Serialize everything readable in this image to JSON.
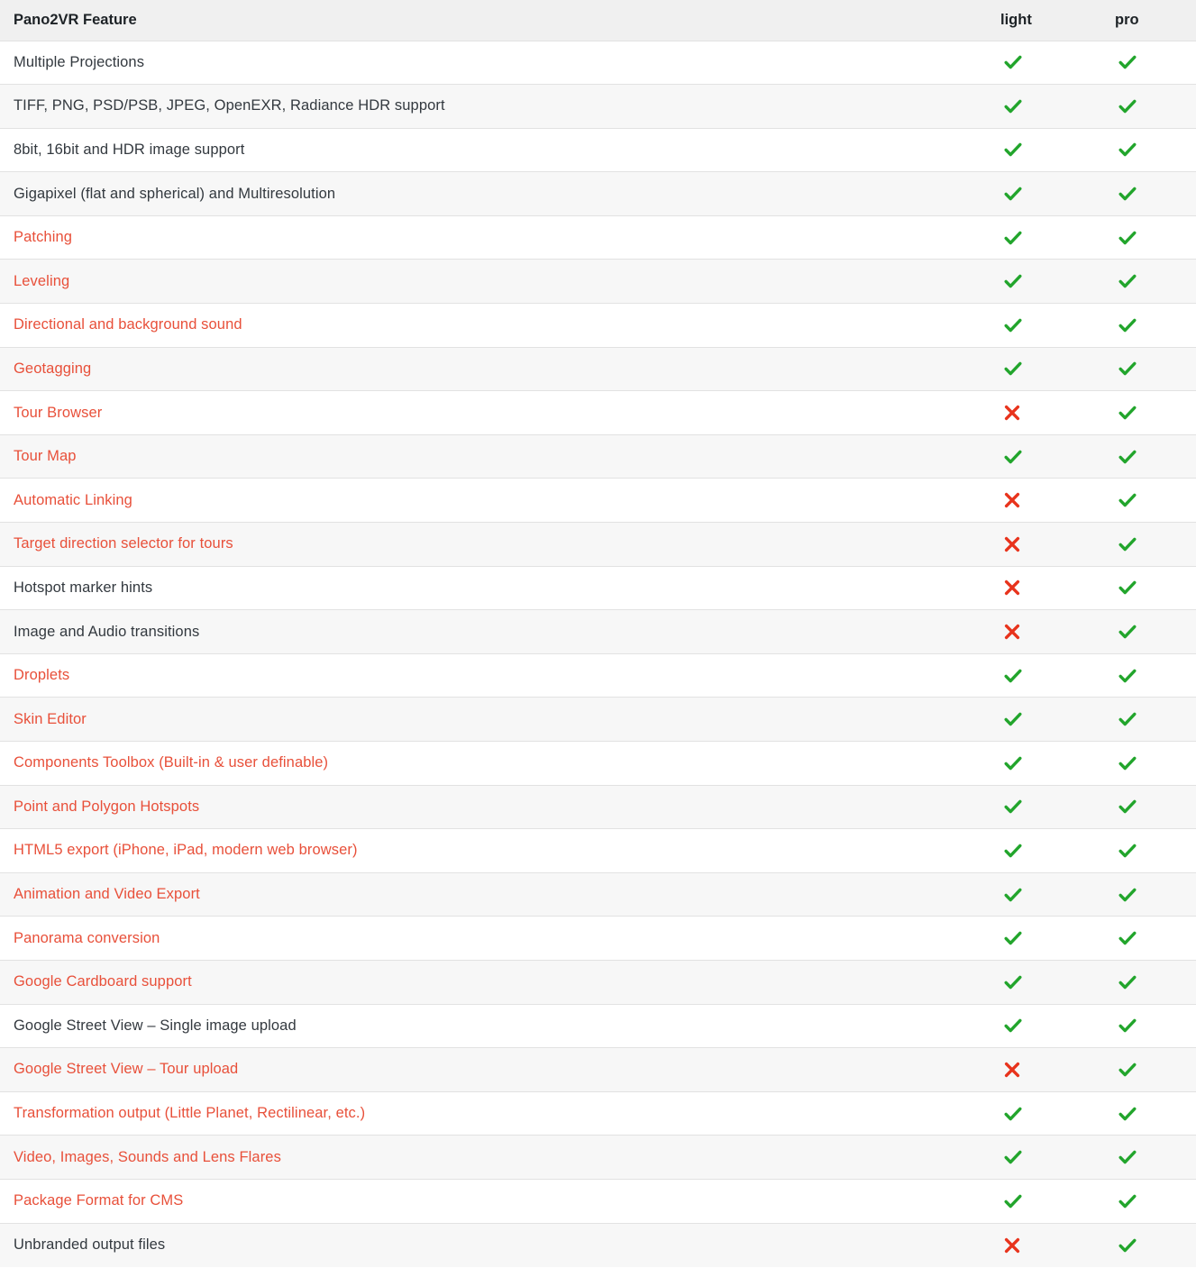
{
  "table": {
    "columns": {
      "feature": "Pano2VR Feature",
      "light": "light",
      "pro": "pro"
    },
    "colors": {
      "header_bg": "#f0f0f0",
      "row_alt_bg": "#f7f7f7",
      "row_bg": "#ffffff",
      "border": "#e2e2e2",
      "text": "#33393f",
      "link": "#e8503a",
      "check_green": "#22a52c",
      "cross_red": "#e8331c"
    },
    "icons": {
      "yes": "check-icon",
      "no": "cross-icon"
    },
    "rows": [
      {
        "feature": "Multiple Projections",
        "link": false,
        "light": "yes",
        "pro": "yes"
      },
      {
        "feature": "TIFF, PNG, PSD/PSB, JPEG, OpenEXR, Radiance HDR support",
        "link": false,
        "light": "yes",
        "pro": "yes"
      },
      {
        "feature": "8bit, 16bit and HDR image support",
        "link": false,
        "light": "yes",
        "pro": "yes"
      },
      {
        "feature": "Gigapixel (flat and spherical) and Multiresolution",
        "link": false,
        "light": "yes",
        "pro": "yes"
      },
      {
        "feature": "Patching",
        "link": true,
        "light": "yes",
        "pro": "yes"
      },
      {
        "feature": "Leveling",
        "link": true,
        "light": "yes",
        "pro": "yes"
      },
      {
        "feature": "Directional and background sound",
        "link": true,
        "light": "yes",
        "pro": "yes"
      },
      {
        "feature": "Geotagging",
        "link": true,
        "light": "yes",
        "pro": "yes"
      },
      {
        "feature": "Tour Browser",
        "link": true,
        "light": "no",
        "pro": "yes"
      },
      {
        "feature": "Tour Map",
        "link": true,
        "light": "yes",
        "pro": "yes"
      },
      {
        "feature": "Automatic Linking",
        "link": true,
        "light": "no",
        "pro": "yes"
      },
      {
        "feature": "Target direction selector for tours",
        "link": true,
        "light": "no",
        "pro": "yes"
      },
      {
        "feature": "Hotspot marker hints",
        "link": false,
        "light": "no",
        "pro": "yes"
      },
      {
        "feature": "Image and Audio transitions",
        "link": false,
        "light": "no",
        "pro": "yes"
      },
      {
        "feature": "Droplets",
        "link": true,
        "light": "yes",
        "pro": "yes"
      },
      {
        "feature": "Skin Editor",
        "link": true,
        "light": "yes",
        "pro": "yes"
      },
      {
        "feature": "Components Toolbox (Built-in & user definable)",
        "link": true,
        "light": "yes",
        "pro": "yes"
      },
      {
        "feature": "Point and Polygon Hotspots",
        "link": true,
        "light": "yes",
        "pro": "yes"
      },
      {
        "feature": "HTML5 export (iPhone, iPad, modern web browser)",
        "link": true,
        "light": "yes",
        "pro": "yes"
      },
      {
        "feature": "Animation and Video Export",
        "link": true,
        "light": "yes",
        "pro": "yes"
      },
      {
        "feature": "Panorama conversion",
        "link": true,
        "light": "yes",
        "pro": "yes"
      },
      {
        "feature": "Google Cardboard support",
        "link": true,
        "light": "yes",
        "pro": "yes"
      },
      {
        "feature": "Google Street View – Single image upload",
        "link": false,
        "light": "yes",
        "pro": "yes"
      },
      {
        "feature": "Google Street View – Tour upload",
        "link": true,
        "light": "no",
        "pro": "yes"
      },
      {
        "feature": "Transformation output (Little Planet, Rectilinear, etc.)",
        "link": true,
        "light": "yes",
        "pro": "yes"
      },
      {
        "feature": "Video, Images, Sounds and Lens Flares",
        "link": true,
        "light": "yes",
        "pro": "yes"
      },
      {
        "feature": "Package Format for CMS",
        "link": true,
        "light": "yes",
        "pro": "yes"
      },
      {
        "feature": "Unbranded output files",
        "link": false,
        "light": "no",
        "pro": "yes"
      }
    ]
  }
}
